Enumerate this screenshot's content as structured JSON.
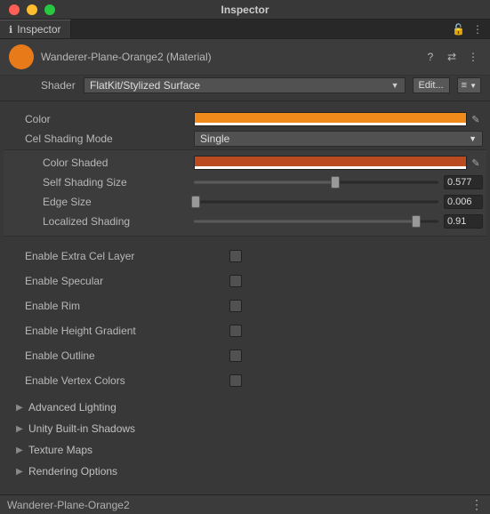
{
  "window": {
    "title": "Inspector"
  },
  "tabs": {
    "active": "Inspector"
  },
  "header": {
    "material_name": "Wanderer-Plane-Orange2 (Material)",
    "help_icon": "?",
    "preset_icon": "⇄",
    "menu_icon": "⋮"
  },
  "shader": {
    "label": "Shader",
    "value": "FlatKit/Stylized Surface",
    "edit_button": "Edit...",
    "list_icon": "≡"
  },
  "props": {
    "color": {
      "label": "Color",
      "value": "#f08a1a"
    },
    "cel_mode": {
      "label": "Cel Shading Mode",
      "value": "Single"
    },
    "color_shaded": {
      "label": "Color Shaded",
      "value": "#ba4b21"
    },
    "self_shading_size": {
      "label": "Self Shading Size",
      "value": "0.577",
      "pct": 57.7
    },
    "edge_size": {
      "label": "Edge Size",
      "value": "0.006",
      "pct": 0.6
    },
    "localized_shading": {
      "label": "Localized Shading",
      "value": "0.91",
      "pct": 91
    }
  },
  "toggles": {
    "extra_cel": "Enable Extra Cel Layer",
    "specular": "Enable Specular",
    "rim": "Enable Rim",
    "height_gradient": "Enable Height Gradient",
    "outline": "Enable Outline",
    "vertex_colors": "Enable Vertex Colors"
  },
  "foldouts": {
    "adv_lighting": "Advanced Lighting",
    "builtin_shadows": "Unity Built-in Shadows",
    "texture_maps": "Texture Maps",
    "rendering": "Rendering Options"
  },
  "status": {
    "text": "Wanderer-Plane-Orange2"
  }
}
